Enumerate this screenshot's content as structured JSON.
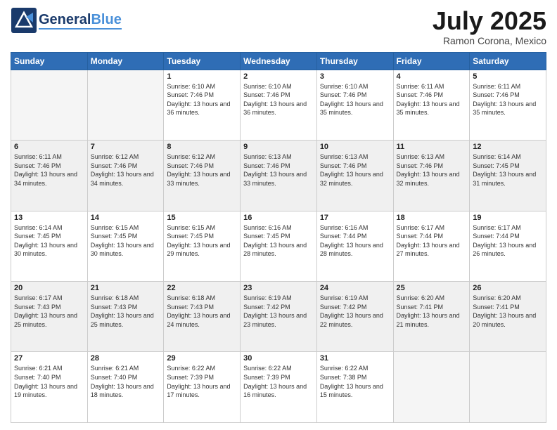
{
  "header": {
    "logo_general": "General",
    "logo_blue": "Blue",
    "month_title": "July 2025",
    "subtitle": "Ramon Corona, Mexico"
  },
  "days_of_week": [
    "Sunday",
    "Monday",
    "Tuesday",
    "Wednesday",
    "Thursday",
    "Friday",
    "Saturday"
  ],
  "weeks": [
    [
      {
        "day": "",
        "info": ""
      },
      {
        "day": "",
        "info": ""
      },
      {
        "day": "1",
        "info": "Sunrise: 6:10 AM\nSunset: 7:46 PM\nDaylight: 13 hours and 36 minutes."
      },
      {
        "day": "2",
        "info": "Sunrise: 6:10 AM\nSunset: 7:46 PM\nDaylight: 13 hours and 36 minutes."
      },
      {
        "day": "3",
        "info": "Sunrise: 6:10 AM\nSunset: 7:46 PM\nDaylight: 13 hours and 35 minutes."
      },
      {
        "day": "4",
        "info": "Sunrise: 6:11 AM\nSunset: 7:46 PM\nDaylight: 13 hours and 35 minutes."
      },
      {
        "day": "5",
        "info": "Sunrise: 6:11 AM\nSunset: 7:46 PM\nDaylight: 13 hours and 35 minutes."
      }
    ],
    [
      {
        "day": "6",
        "info": "Sunrise: 6:11 AM\nSunset: 7:46 PM\nDaylight: 13 hours and 34 minutes."
      },
      {
        "day": "7",
        "info": "Sunrise: 6:12 AM\nSunset: 7:46 PM\nDaylight: 13 hours and 34 minutes."
      },
      {
        "day": "8",
        "info": "Sunrise: 6:12 AM\nSunset: 7:46 PM\nDaylight: 13 hours and 33 minutes."
      },
      {
        "day": "9",
        "info": "Sunrise: 6:13 AM\nSunset: 7:46 PM\nDaylight: 13 hours and 33 minutes."
      },
      {
        "day": "10",
        "info": "Sunrise: 6:13 AM\nSunset: 7:46 PM\nDaylight: 13 hours and 32 minutes."
      },
      {
        "day": "11",
        "info": "Sunrise: 6:13 AM\nSunset: 7:46 PM\nDaylight: 13 hours and 32 minutes."
      },
      {
        "day": "12",
        "info": "Sunrise: 6:14 AM\nSunset: 7:45 PM\nDaylight: 13 hours and 31 minutes."
      }
    ],
    [
      {
        "day": "13",
        "info": "Sunrise: 6:14 AM\nSunset: 7:45 PM\nDaylight: 13 hours and 30 minutes."
      },
      {
        "day": "14",
        "info": "Sunrise: 6:15 AM\nSunset: 7:45 PM\nDaylight: 13 hours and 30 minutes."
      },
      {
        "day": "15",
        "info": "Sunrise: 6:15 AM\nSunset: 7:45 PM\nDaylight: 13 hours and 29 minutes."
      },
      {
        "day": "16",
        "info": "Sunrise: 6:16 AM\nSunset: 7:45 PM\nDaylight: 13 hours and 28 minutes."
      },
      {
        "day": "17",
        "info": "Sunrise: 6:16 AM\nSunset: 7:44 PM\nDaylight: 13 hours and 28 minutes."
      },
      {
        "day": "18",
        "info": "Sunrise: 6:17 AM\nSunset: 7:44 PM\nDaylight: 13 hours and 27 minutes."
      },
      {
        "day": "19",
        "info": "Sunrise: 6:17 AM\nSunset: 7:44 PM\nDaylight: 13 hours and 26 minutes."
      }
    ],
    [
      {
        "day": "20",
        "info": "Sunrise: 6:17 AM\nSunset: 7:43 PM\nDaylight: 13 hours and 25 minutes."
      },
      {
        "day": "21",
        "info": "Sunrise: 6:18 AM\nSunset: 7:43 PM\nDaylight: 13 hours and 25 minutes."
      },
      {
        "day": "22",
        "info": "Sunrise: 6:18 AM\nSunset: 7:43 PM\nDaylight: 13 hours and 24 minutes."
      },
      {
        "day": "23",
        "info": "Sunrise: 6:19 AM\nSunset: 7:42 PM\nDaylight: 13 hours and 23 minutes."
      },
      {
        "day": "24",
        "info": "Sunrise: 6:19 AM\nSunset: 7:42 PM\nDaylight: 13 hours and 22 minutes."
      },
      {
        "day": "25",
        "info": "Sunrise: 6:20 AM\nSunset: 7:41 PM\nDaylight: 13 hours and 21 minutes."
      },
      {
        "day": "26",
        "info": "Sunrise: 6:20 AM\nSunset: 7:41 PM\nDaylight: 13 hours and 20 minutes."
      }
    ],
    [
      {
        "day": "27",
        "info": "Sunrise: 6:21 AM\nSunset: 7:40 PM\nDaylight: 13 hours and 19 minutes."
      },
      {
        "day": "28",
        "info": "Sunrise: 6:21 AM\nSunset: 7:40 PM\nDaylight: 13 hours and 18 minutes."
      },
      {
        "day": "29",
        "info": "Sunrise: 6:22 AM\nSunset: 7:39 PM\nDaylight: 13 hours and 17 minutes."
      },
      {
        "day": "30",
        "info": "Sunrise: 6:22 AM\nSunset: 7:39 PM\nDaylight: 13 hours and 16 minutes."
      },
      {
        "day": "31",
        "info": "Sunrise: 6:22 AM\nSunset: 7:38 PM\nDaylight: 13 hours and 15 minutes."
      },
      {
        "day": "",
        "info": ""
      },
      {
        "day": "",
        "info": ""
      }
    ]
  ]
}
